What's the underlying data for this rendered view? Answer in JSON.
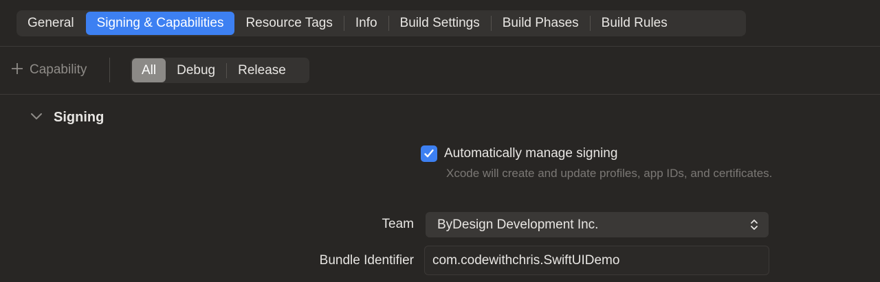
{
  "tabs": [
    {
      "label": "General",
      "active": false
    },
    {
      "label": "Signing & Capabilities",
      "active": true
    },
    {
      "label": "Resource Tags",
      "active": false
    },
    {
      "label": "Info",
      "active": false
    },
    {
      "label": "Build Settings",
      "active": false
    },
    {
      "label": "Build Phases",
      "active": false
    },
    {
      "label": "Build Rules",
      "active": false
    }
  ],
  "toolbar": {
    "capability_label": "Capability",
    "capability_icon": "plus-icon",
    "filters": [
      {
        "label": "All",
        "active": true
      },
      {
        "label": "Debug",
        "active": false
      },
      {
        "label": "Release",
        "active": false
      }
    ]
  },
  "signing": {
    "title": "Signing",
    "auto_manage": {
      "label": "Automatically manage signing",
      "checked": true,
      "help": "Xcode will create and update profiles, app IDs, and certificates."
    },
    "team": {
      "label": "Team",
      "value": "ByDesign Development Inc."
    },
    "bundle_identifier": {
      "label": "Bundle Identifier",
      "value": "com.codewithchris.SwiftUIDemo"
    }
  },
  "colors": {
    "accent": "#3d80f2",
    "background": "#282624",
    "segment_active": "#8c8a87"
  }
}
